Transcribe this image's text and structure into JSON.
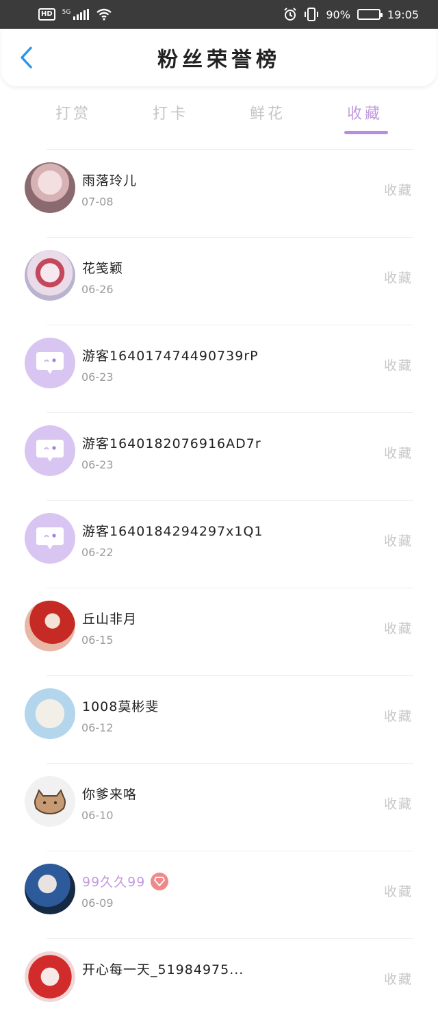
{
  "status_bar": {
    "hd": "HD",
    "network": "5G",
    "battery": "90%",
    "battery_level": 0.9,
    "time": "19:05"
  },
  "header": {
    "title": "粉丝荣誉榜",
    "back_icon": "chevron-left-icon",
    "accent": "#2196f3"
  },
  "tabs": [
    {
      "label": "打赏",
      "active": false
    },
    {
      "label": "打卡",
      "active": false
    },
    {
      "label": "鲜花",
      "active": false
    },
    {
      "label": "收藏",
      "active": true
    }
  ],
  "theme": {
    "accent": "#c49bdf"
  },
  "fans": [
    {
      "name": "雨落玲儿",
      "date": "07-08",
      "action": "收藏"
    },
    {
      "name": "花笺颖",
      "date": "06-26",
      "action": "收藏"
    },
    {
      "name": "游客1640174744907​39rP",
      "date": "06-23",
      "action": "收藏"
    },
    {
      "name": "游客1640182076916AD7r",
      "date": "06-23",
      "action": "收藏"
    },
    {
      "name": "游客1640184294297x1Q1",
      "date": "06-22",
      "action": "收藏"
    },
    {
      "name": "丘山非月",
      "date": "06-15",
      "action": "收藏"
    },
    {
      "name": "1008莫彬斐",
      "date": "06-12",
      "action": "收藏"
    },
    {
      "name": "你爹来咯",
      "date": "06-10",
      "action": "收藏"
    },
    {
      "name": "99久久99",
      "date": "06-09",
      "action": "收藏"
    },
    {
      "name": "开心每一天_51984975...",
      "date": "",
      "action": "收藏"
    }
  ]
}
